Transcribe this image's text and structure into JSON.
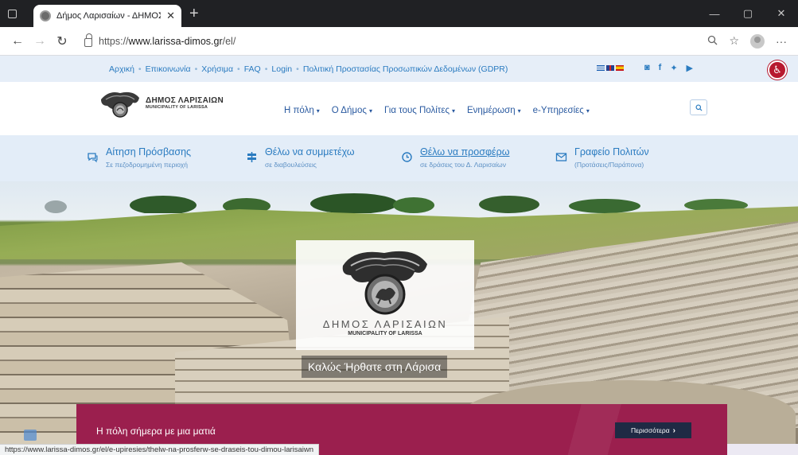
{
  "browser": {
    "tab_title": "Δήμος Λαρισαίων - ΔΗΜΟΣ ΛΑΡ",
    "url_prefix": "https://",
    "url_domain": "www.larissa-dimos.gr",
    "url_path": "/el/",
    "status_url": "https://www.larissa-dimos.gr/el/e-upiresies/thelw-na-prosferw-se-draseis-tou-dimou-larisaiwn"
  },
  "top_links": [
    "Αρχική",
    "Επικοινωνία",
    "Χρήσιμα",
    "FAQ",
    "Login",
    "Πολιτική Προστασίας Προσωπικών Δεδομένων (GDPR)"
  ],
  "logo": {
    "greek": "ΔΗΜΟΣ ΛΑΡΙΣΑΙΩΝ",
    "english": "MUNICIPALITY OF LARISSA"
  },
  "main_nav": [
    {
      "label": "Η πόλη"
    },
    {
      "label": "Ο Δήμος"
    },
    {
      "label": "Για τους Πολίτες"
    },
    {
      "label": "Ενημέρωση"
    },
    {
      "label": "e-Υπηρεσίες"
    }
  ],
  "quick_links": [
    {
      "title": "Αίτηση Πρόσβασης",
      "subtitle": "Σε πεζοδρομημένη περιοχή",
      "icon": "chat-icon"
    },
    {
      "title": "Θέλω να συμμετέχω",
      "subtitle": "σε διαβουλεύσεις",
      "icon": "signpost-icon"
    },
    {
      "title": "Θέλω να προσφέρω",
      "subtitle": "σε δράσεις του Δ. Λαρισαίων",
      "icon": "clock-icon"
    },
    {
      "title": "Γραφείο Πολιτών",
      "subtitle": "(Προτάσεις/Παράπονα)",
      "icon": "envelope-icon"
    }
  ],
  "hero": {
    "logo_greek": "ΔΗΜΟΣ ΛΑΡΙΣΑΙΩΝ",
    "logo_english": "MUNICIPALITY OF LARISSA",
    "welcome": "Καλώς Ήρθατε στη Λάρισα",
    "bar_title": "Η πόλη σήμερα με μια ματιά",
    "more_label": "Περισσότερα"
  },
  "colors": {
    "link": "#2a7bc0",
    "accent": "#9b1f4e",
    "button_dark": "#1f2a44",
    "accessibility": "#b7192f"
  }
}
